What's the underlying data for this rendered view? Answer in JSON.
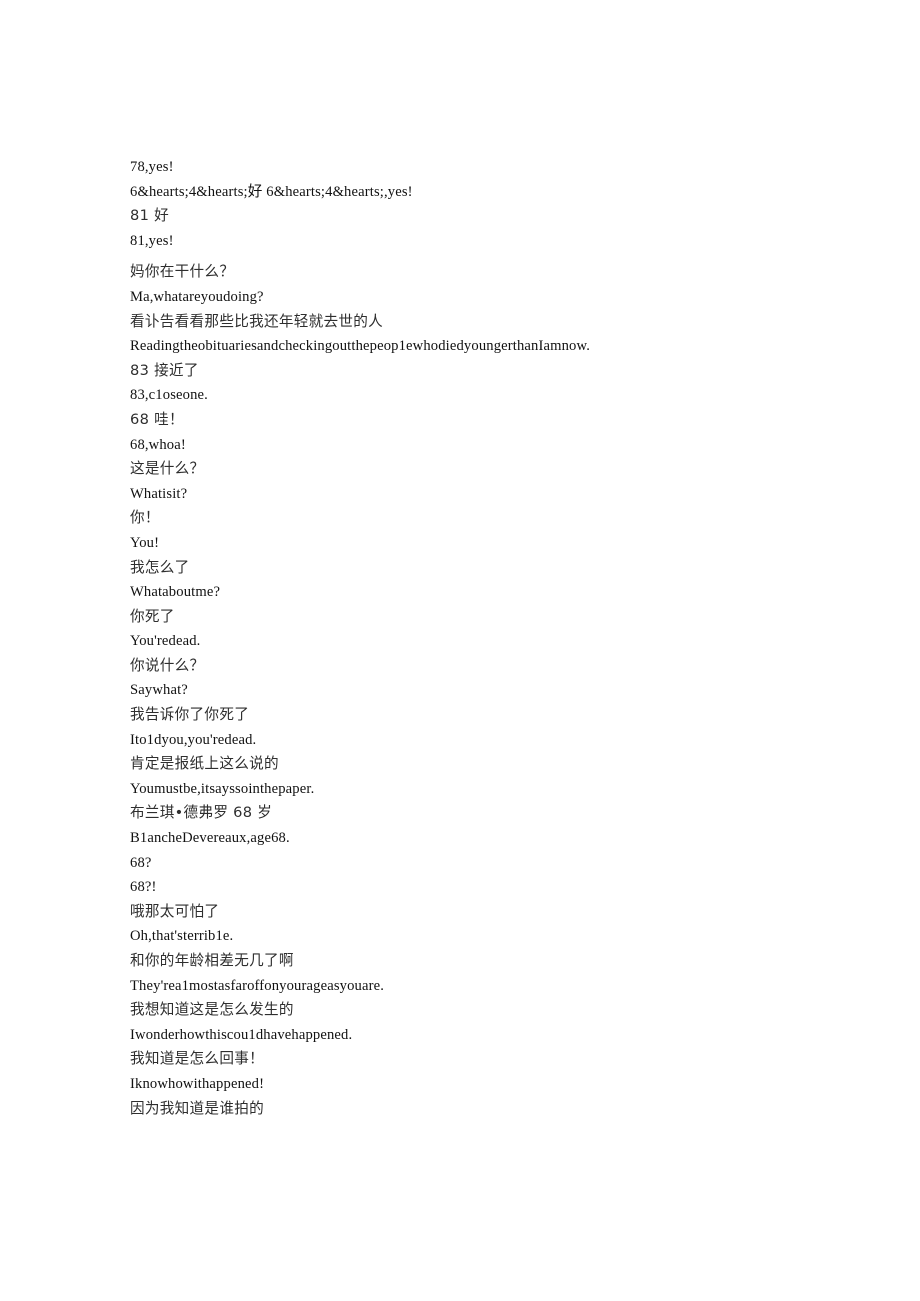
{
  "document": {
    "type": "bilingual-subtitle-transcript",
    "page_background": "#ffffff",
    "text_color_latin": "#111111",
    "text_color_cjk": "#2e2e2e",
    "lines": [
      {
        "id": "l01",
        "lang": "en",
        "text": "78,yes!"
      },
      {
        "id": "l02",
        "lang": "en",
        "text": "6&hearts;4&hearts;好 6&hearts;4&hearts;,yes!"
      },
      {
        "id": "l03",
        "lang": "zh",
        "text": "81 好"
      },
      {
        "id": "l04",
        "lang": "en",
        "text": "81,yes!"
      },
      {
        "id": "l05",
        "lang": "zh",
        "text": "妈你在干什么？",
        "gap_before": true
      },
      {
        "id": "l06",
        "lang": "en",
        "text": "Ma,whatareyoudoing?"
      },
      {
        "id": "l07",
        "lang": "zh",
        "text": "看讣告看看那些比我还年轻就去世的人"
      },
      {
        "id": "l08",
        "lang": "en",
        "text": "Readingtheobituariesandcheckingoutthepeop1ewhodiedyoungerthanIamnow."
      },
      {
        "id": "l09",
        "lang": "zh",
        "text": "83 接近了"
      },
      {
        "id": "l10",
        "lang": "en",
        "text": "83,c1oseone."
      },
      {
        "id": "l11",
        "lang": "zh",
        "text": "68 哇！"
      },
      {
        "id": "l12",
        "lang": "en",
        "text": "68,whoa!"
      },
      {
        "id": "l13",
        "lang": "zh",
        "text": "这是什么？"
      },
      {
        "id": "l14",
        "lang": "en",
        "text": "Whatisit?"
      },
      {
        "id": "l15",
        "lang": "zh",
        "text": "你！"
      },
      {
        "id": "l16",
        "lang": "en",
        "text": "You!"
      },
      {
        "id": "l17",
        "lang": "zh",
        "text": "我怎么了"
      },
      {
        "id": "l18",
        "lang": "en",
        "text": "Whataboutme?"
      },
      {
        "id": "l19",
        "lang": "zh",
        "text": "你死了"
      },
      {
        "id": "l20",
        "lang": "en",
        "text": "You'redead."
      },
      {
        "id": "l21",
        "lang": "zh",
        "text": "你说什么？"
      },
      {
        "id": "l22",
        "lang": "en",
        "text": "Saywhat?"
      },
      {
        "id": "l23",
        "lang": "zh",
        "text": "我告诉你了你死了"
      },
      {
        "id": "l24",
        "lang": "en",
        "text": "Ito1dyou,you'redead."
      },
      {
        "id": "l25",
        "lang": "zh",
        "text": "肯定是报纸上这么说的"
      },
      {
        "id": "l26",
        "lang": "en",
        "text": "Youmustbe,itsayssointhepaper."
      },
      {
        "id": "l27",
        "lang": "zh",
        "text": "布兰琪•德弗罗 68 岁"
      },
      {
        "id": "l28",
        "lang": "en",
        "text": "B1ancheDevereaux,age68."
      },
      {
        "id": "l29",
        "lang": "en",
        "text": "68?"
      },
      {
        "id": "l30",
        "lang": "en",
        "text": "68?!"
      },
      {
        "id": "l31",
        "lang": "zh",
        "text": "哦那太可怕了"
      },
      {
        "id": "l32",
        "lang": "en",
        "text": "Oh,that'sterrib1e."
      },
      {
        "id": "l33",
        "lang": "zh",
        "text": "和你的年龄相差无几了啊"
      },
      {
        "id": "l34",
        "lang": "en",
        "text": "They'rea1mostasfaroffonyourageasyouare."
      },
      {
        "id": "l35",
        "lang": "zh",
        "text": "我想知道这是怎么发生的"
      },
      {
        "id": "l36",
        "lang": "en",
        "text": "Iwonderhowthiscou1dhavehappened."
      },
      {
        "id": "l37",
        "lang": "zh",
        "text": "我知道是怎么回事！"
      },
      {
        "id": "l38",
        "lang": "en",
        "text": "Iknowhowithappened!"
      },
      {
        "id": "l39",
        "lang": "zh",
        "text": "因为我知道是谁拍的"
      }
    ]
  }
}
